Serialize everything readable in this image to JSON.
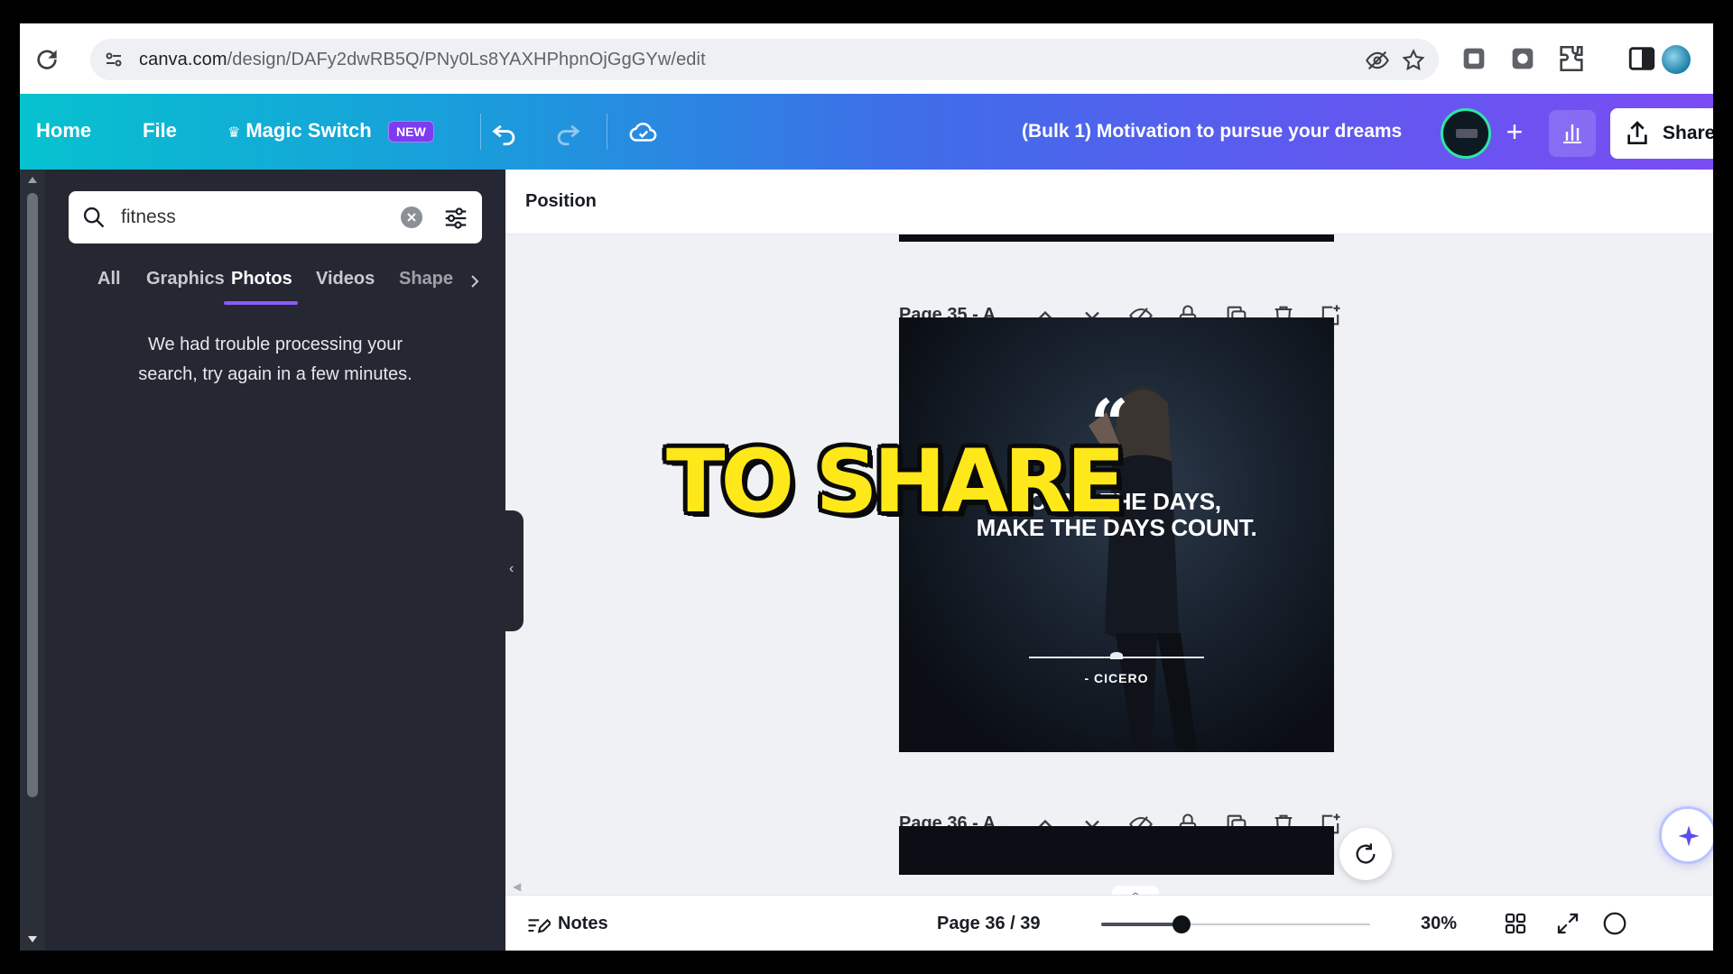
{
  "browser": {
    "url_host": "canva.com",
    "url_path": "/design/DAFy2dwRB5Q/PNy0Ls8YAXHPhpnOjGgGYw/edit"
  },
  "header": {
    "home": "Home",
    "file": "File",
    "magic_switch": "Magic Switch",
    "badge": "NEW",
    "doc_title": "(Bulk 1) Motivation to pursue your dreams",
    "share": "Share"
  },
  "side_panel": {
    "search_value": "fitness",
    "tabs": [
      {
        "label": "All"
      },
      {
        "label": "Graphics"
      },
      {
        "label": "Photos"
      },
      {
        "label": "Videos"
      },
      {
        "label": "Shape"
      }
    ],
    "active_tab": "Photos",
    "error_line1": "We had trouble processing your",
    "error_line2": "search, try again in a few minutes."
  },
  "editor": {
    "position_label": "Position",
    "pages": [
      {
        "label": "Page 35 - A..",
        "quote_line1": "COUNT THE DAYS,",
        "quote_line2": "MAKE THE DAYS COUNT.",
        "quote_mark": "“",
        "author": "- CICERO"
      },
      {
        "label": "Page 36 - A.."
      }
    ],
    "overlay_caption": "TO SHARE"
  },
  "bottom_bar": {
    "notes": "Notes",
    "page_count": "Page 36 / 39",
    "zoom": "30%",
    "zoom_fraction": 0.3
  },
  "colors": {
    "header_gradient_start": "#06c2cf",
    "header_gradient_end": "#7a4cf2",
    "panel_bg": "#252732",
    "active_tab_underline": "#8b5cf6",
    "caption_yellow": "#ffe81a"
  }
}
